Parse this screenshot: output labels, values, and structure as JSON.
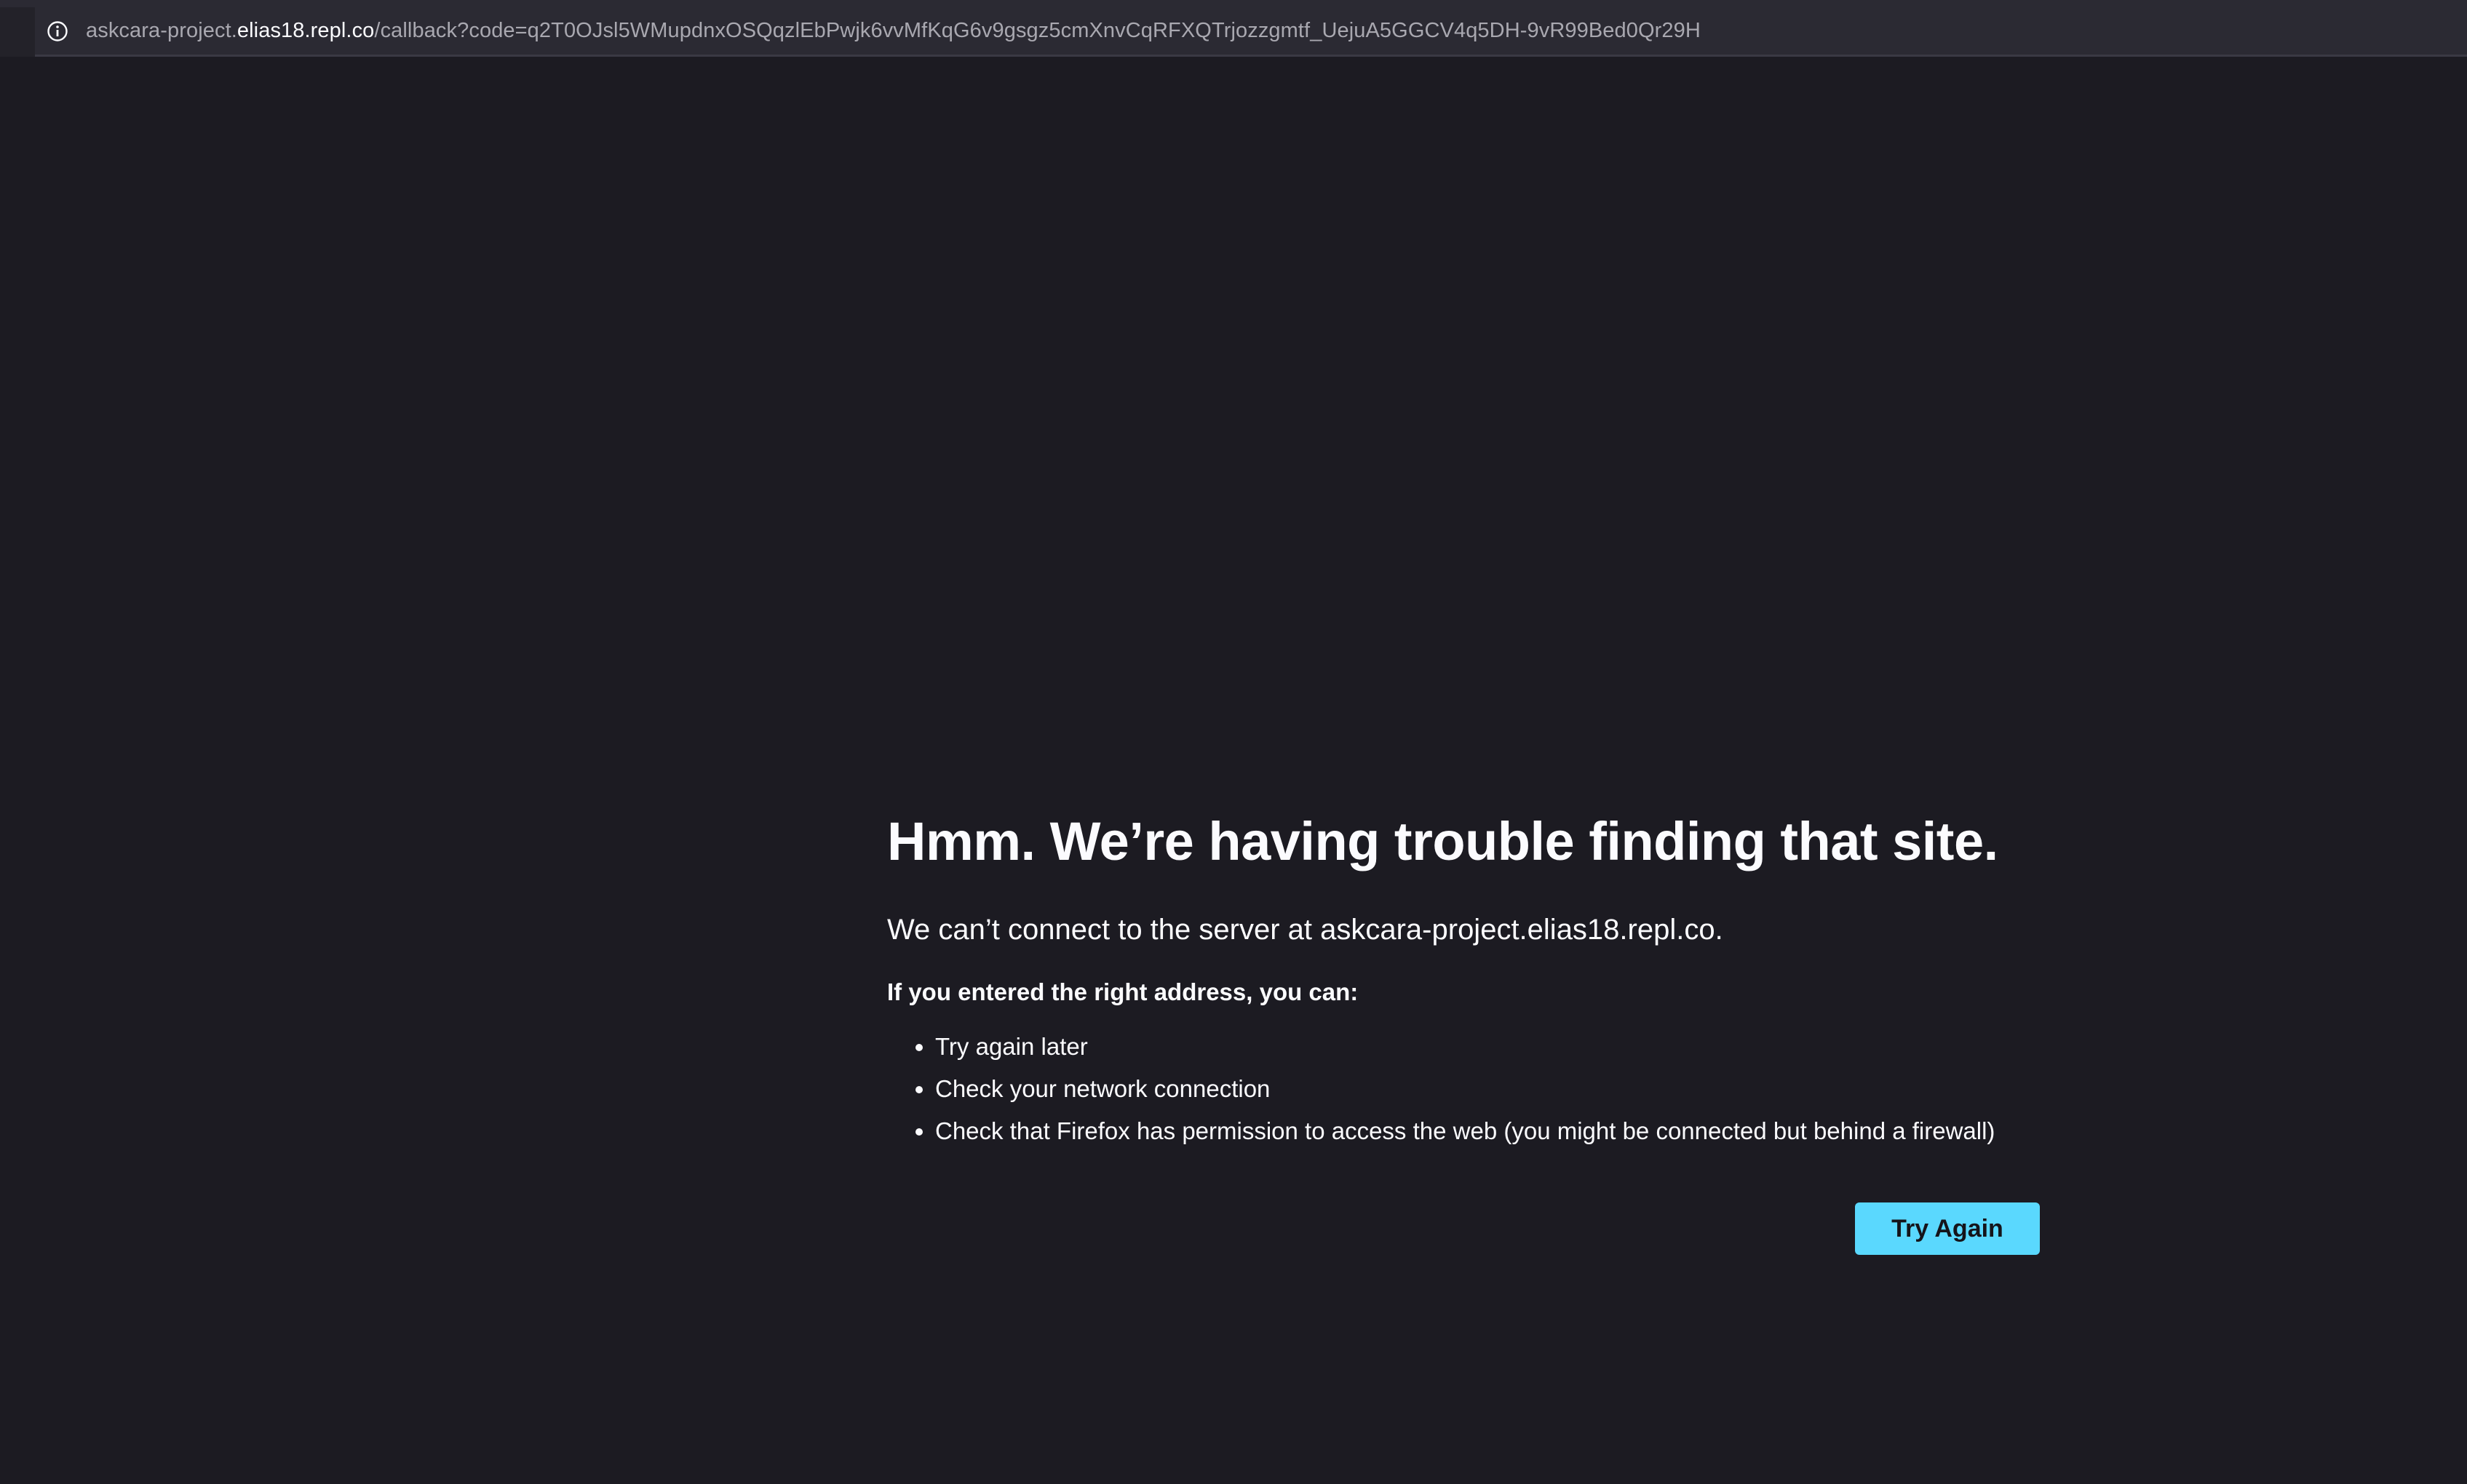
{
  "browser": {
    "url_prefix": "askcara-project.",
    "url_host": "elias18.repl.co",
    "url_path": "/callback?code=q2T0OJsl5WMupdnxOSQqzlEbPwjk6vvMfKqG6v9gsgz5cmXnvCqRFXQTrjozzgmtf_UejuA5GGCV4q5DH-9vR99Bed0Qr29H",
    "site_info_icon": "info-circle-icon"
  },
  "error_page": {
    "title": "Hmm. We’re having trouble finding that site.",
    "description": "We can’t connect to the server at askcara-project.elias18.repl.co.",
    "subtitle": "If you entered the right address, you can:",
    "suggestions": [
      "Try again later",
      "Check your network connection",
      "Check that Firefox has permission to access the web (you might be connected but behind a firewall)"
    ],
    "button_label": "Try Again"
  },
  "colors": {
    "background": "#1c1b22",
    "urlbar": "#2b2a33",
    "accent_button": "#5ad8fe",
    "text": "#fbfbfe"
  }
}
